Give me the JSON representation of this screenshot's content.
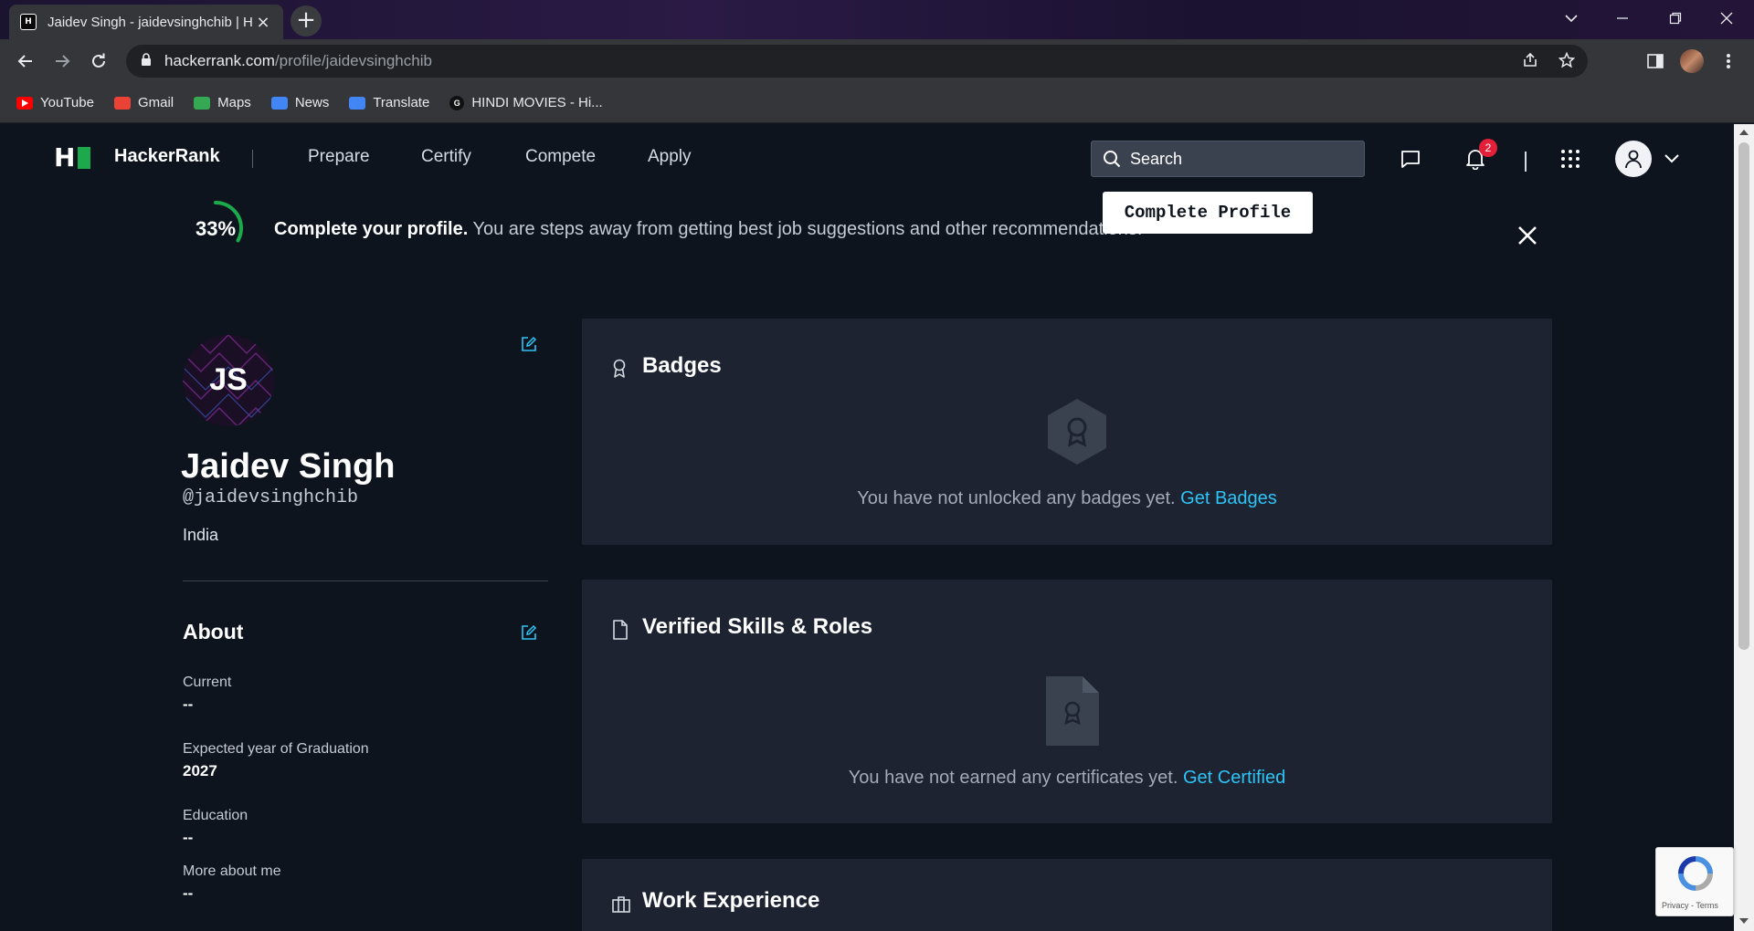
{
  "browser": {
    "tab_title": "Jaidev Singh - jaidevsinghchib | H",
    "url_host": "hackerrank.com",
    "url_path": "/profile/jaidevsinghchib",
    "bookmarks": [
      {
        "label": "YouTube",
        "icon": "youtube-icon",
        "color": "#ff0000"
      },
      {
        "label": "Gmail",
        "icon": "gmail-icon",
        "color": "#ea4335"
      },
      {
        "label": "Maps",
        "icon": "maps-icon",
        "color": "#34a853"
      },
      {
        "label": "News",
        "icon": "news-icon",
        "color": "#4285f4"
      },
      {
        "label": "Translate",
        "icon": "translate-icon",
        "color": "#4285f4"
      },
      {
        "label": "HINDI MOVIES - Hi...",
        "icon": "g-icon",
        "color": "#111111"
      }
    ]
  },
  "nav": {
    "brand": "HackerRank",
    "links": [
      "Prepare",
      "Certify",
      "Compete",
      "Apply"
    ],
    "search_placeholder": "Search",
    "notification_count": "2"
  },
  "banner": {
    "percent": "33%",
    "progress": 0.33,
    "title": "Complete your profile.",
    "message": " You are steps away from getting best job suggestions and other recommendations.",
    "button": "Complete Profile"
  },
  "profile": {
    "initials": "JS",
    "name": "Jaidev Singh",
    "handle": "@jaidevsinghchib",
    "country": "India"
  },
  "about": {
    "title": "About",
    "fields": [
      {
        "label": "Current",
        "value": "--"
      },
      {
        "label": "Expected year of Graduation",
        "value": "2027"
      },
      {
        "label": "Education",
        "value": "--"
      },
      {
        "label": "More about me",
        "value": "--"
      }
    ]
  },
  "cards": {
    "badges": {
      "title": "Badges",
      "empty": "You have not unlocked any badges yet.",
      "link": "Get Badges"
    },
    "skills": {
      "title": "Verified Skills & Roles",
      "empty": "You have not earned any certificates yet.",
      "link": "Get Certified"
    },
    "work": {
      "title": "Work Experience"
    }
  },
  "recaptcha": {
    "text": "Privacy - Terms"
  },
  "colors": {
    "accent_green": "#1ba94c",
    "link_blue": "#2ec4f6",
    "page_bg": "#0e141e",
    "card_bg": "#1d2330"
  }
}
